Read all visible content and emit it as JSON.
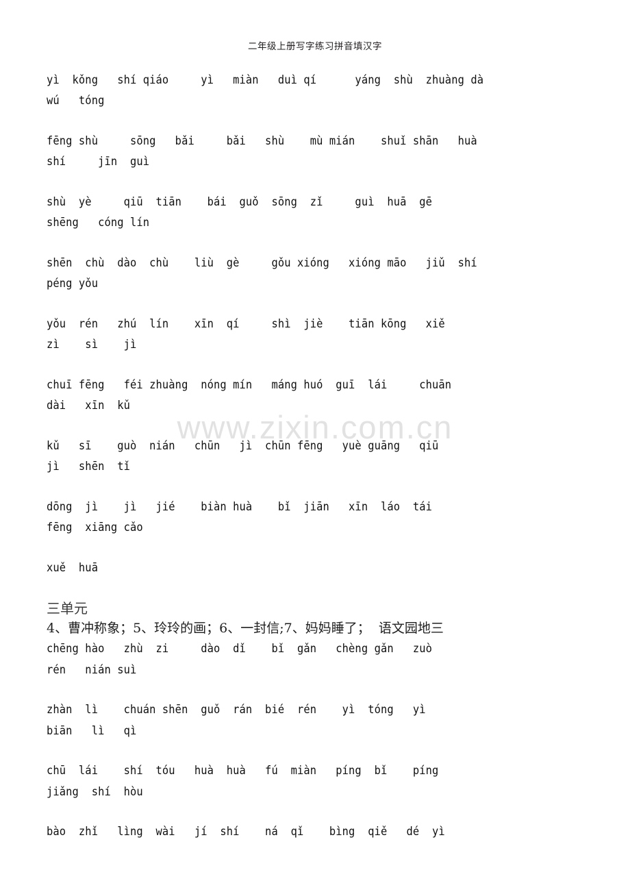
{
  "document": {
    "header_title": "二年级上册写字练习拼音填汉字",
    "watermark": "www.zixin.com.cn"
  },
  "unit_two": {
    "paragraphs": [
      "yì  kǒng   shí qiáo     yì   miàn   duì qí      yáng  shù  zhuàng dà\nwú   tóng",
      "fēng shù     sōng   bǎi     bǎi   shù    mù mián    shuǐ shān   huà\nshí     jīn  guì",
      "shù  yè     qiū  tiān    bái  guǒ  sōng  zǐ     guì  huā  gē\nshēng   cóng lín",
      "shēn  chù  dào  chù    liù  gè     gǒu xióng   xióng māo   jiǔ  shí\npéng yǒu",
      "yǒu  rén   zhú  lín    xīn  qí     shì  jiè    tiān kōng   xiě\nzì    sì    jì",
      "chuī fēng   féi zhuàng  nóng mín   máng huó  guī  lái     chuān\ndài   xīn  kǔ",
      "kǔ   sī    guò  nián   chūn   jì  chūn fēng   yuè guāng   qiū\njì   shēn  tǐ",
      "dōng  jì    jì   jié    biàn huà    bǐ  jiān   xīn  láo  tái\nfēng  xiāng cǎo",
      "xuě  huā"
    ]
  },
  "unit_three": {
    "heading": "三单元",
    "lesson_list": "4、曹冲称象；5、玲玲的画；6、一封信;7、妈妈睡了；  语文园地三",
    "paragraphs": [
      "chēng hào   zhù  zi     dào  dǐ    bǐ  gǎn   chèng gǎn   zuò\nrén   nián suì",
      "zhàn  lì    chuán shēn  guǒ  rán  bié  rén    yì  tóng   yì\nbiān   lì   qì",
      "chū  lái    shí  tóu   huà  huà   fú  miàn   píng  bǐ    píng\njiǎng  shí  hòu",
      "bào  zhǐ   lìng  wài   jí  shí    ná  qǐ    bìng  qiě   dé  yì"
    ]
  }
}
